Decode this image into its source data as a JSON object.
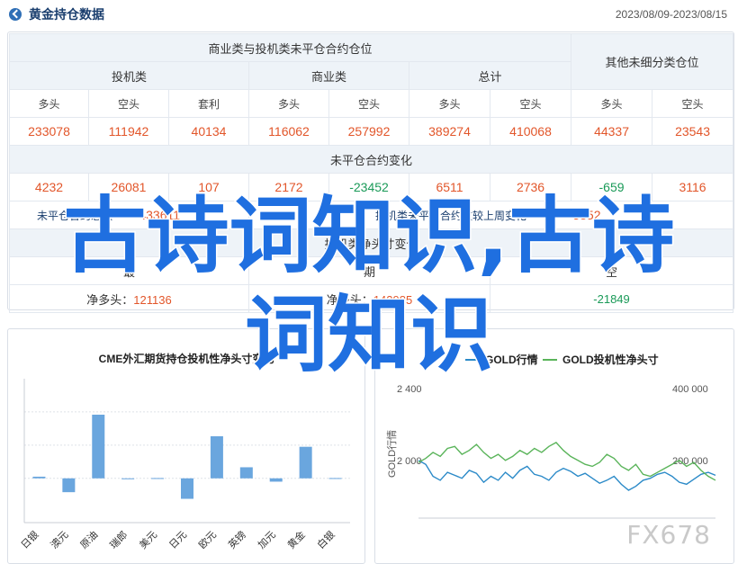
{
  "header": {
    "title": "黄金持仓数据",
    "date_range": "2023/08/09-2023/08/15"
  },
  "table": {
    "group_header_main": "商业类与投机类未平仓合约仓位",
    "group_header_other": "其他未细分类仓位",
    "sub_groups": [
      "投机类",
      "商业类",
      "总计"
    ],
    "columns": [
      "多头",
      "空头",
      "套利",
      "多头",
      "空头",
      "多头",
      "空头",
      "多头",
      "空头"
    ],
    "values": [
      "233078",
      "111942",
      "40134",
      "116062",
      "257992",
      "389274",
      "410068",
      "44337",
      "23543"
    ],
    "change_title": "未平仓合约变化",
    "changes": [
      {
        "v": "4232",
        "neg": false
      },
      {
        "v": "26081",
        "neg": false
      },
      {
        "v": "107",
        "neg": false
      },
      {
        "v": "2172",
        "neg": false
      },
      {
        "v": "-23452",
        "neg": true
      },
      {
        "v": "6511",
        "neg": false
      },
      {
        "v": "2736",
        "neg": false
      },
      {
        "v": "-659",
        "neg": true
      },
      {
        "v": "3116",
        "neg": false
      }
    ],
    "total_label": "未平仓合约总数",
    "total_value": "433611",
    "holding_change_label": "投机类未平仓合约数较上周变化",
    "holding_change_value": "5852",
    "net_title": "投机类净头寸变化",
    "net_labels": [
      "最",
      "期",
      "空"
    ],
    "net_values": [
      {
        "label": "净多头：",
        "value": "121136",
        "color": "red"
      },
      {
        "label": "净多头：",
        "value": "142985",
        "color": "red"
      },
      {
        "label": "",
        "value": "-21849",
        "color": "green"
      }
    ]
  },
  "chart_left": {
    "title": "CME外汇期货持仓投机性净头寸变化"
  },
  "chart_right": {
    "legend_gold": "GOLD行情",
    "legend_net": "GOLD投机性净头寸",
    "y_left_label": "GOLD行情",
    "y_ticks_left": [
      "2 400",
      "2 000"
    ],
    "y_ticks_right": [
      "400 000",
      "200 000"
    ]
  },
  "chart_data": [
    {
      "type": "bar",
      "title": "CME外汇期货持仓投机性净头寸变化",
      "categories": [
        "日银",
        "澳元",
        "原油",
        "瑞郎",
        "美元",
        "日元",
        "欧元",
        "英镑",
        "加元",
        "黄金",
        "白银"
      ],
      "values": [
        0.3,
        -2.5,
        11.5,
        -0.1,
        0.05,
        -3.7,
        7.6,
        2.0,
        -0.6,
        5.7,
        0.05
      ],
      "ylim": [
        -8,
        18
      ]
    },
    {
      "type": "line",
      "series": [
        {
          "name": "GOLD行情",
          "color": "#2b8ac8",
          "values": [
            2090,
            2070,
            2010,
            1990,
            2030,
            2015,
            2000,
            2040,
            2025,
            1980,
            2010,
            1990,
            2030,
            2000,
            2040,
            2060,
            2020,
            2010,
            1990,
            2030,
            2050,
            2035,
            2010,
            2025,
            2000,
            1975,
            1990,
            2010,
            1970,
            1940,
            1960,
            1990,
            2000,
            2020,
            2030,
            2010,
            1980,
            1970,
            1995,
            2020,
            2030,
            2015
          ]
        },
        {
          "name": "GOLD投机性净头寸",
          "color": "#5ab45a",
          "values": [
            2080,
            2100,
            2130,
            2110,
            2150,
            2160,
            2120,
            2140,
            2170,
            2130,
            2100,
            2120,
            2090,
            2110,
            2140,
            2120,
            2150,
            2130,
            2160,
            2180,
            2140,
            2110,
            2090,
            2070,
            2060,
            2080,
            2120,
            2100,
            2060,
            2040,
            2070,
            2020,
            2010,
            2030,
            2050,
            2070,
            2090,
            2060,
            2080,
            2040,
            2010,
            1990
          ]
        }
      ],
      "ylim": [
        1800,
        2500
      ]
    }
  ],
  "overlay": {
    "watermark_line1": "古诗词知识,古诗",
    "watermark_line2": "词知识",
    "brand": "FX678"
  }
}
